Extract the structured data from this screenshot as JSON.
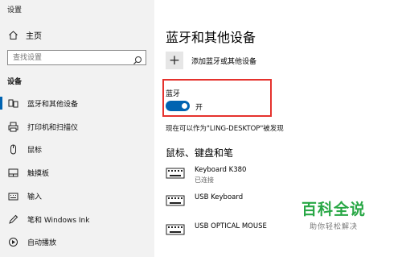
{
  "window": {
    "title": "设置",
    "controls": {
      "minimize": "—",
      "maximize": "☐",
      "close": "✕"
    }
  },
  "sidebar": {
    "home_label": "主页",
    "search_placeholder": "查找设置",
    "section_label": "设备",
    "items": [
      {
        "label": "蓝牙和其他设备",
        "icon": "bluetooth-devices-icon",
        "active": true
      },
      {
        "label": "打印机和扫描仪",
        "icon": "printer-icon"
      },
      {
        "label": "鼠标",
        "icon": "mouse-icon"
      },
      {
        "label": "触摸板",
        "icon": "touchpad-icon"
      },
      {
        "label": "输入",
        "icon": "keyboard-icon"
      },
      {
        "label": "笔和 Windows Ink",
        "icon": "pen-icon"
      },
      {
        "label": "自动播放",
        "icon": "autoplay-icon"
      }
    ]
  },
  "main": {
    "title": "蓝牙和其他设备",
    "add_device_label": "添加蓝牙或其他设备",
    "bluetooth_label": "蓝牙",
    "toggle_state_label": "开",
    "bluetooth_on": true,
    "discoverable_text": "现在可以作为\"LING-DESKTOP\"被发现",
    "section_title": "鼠标、键盘和笔",
    "devices": [
      {
        "name": "Keyboard K380",
        "status": "已连接",
        "icon": "keyboard-icon"
      },
      {
        "name": "USB Keyboard",
        "status": "",
        "icon": "keyboard-icon"
      },
      {
        "name": "USB OPTICAL MOUSE",
        "status": "",
        "icon": "keyboard-icon"
      }
    ]
  },
  "watermark": {
    "big": "百科全说",
    "small": "助你轻松解决"
  },
  "colors": {
    "accent": "#0063b1",
    "highlight_box": "#e5322d",
    "watermark": "#28a745",
    "sidebar_bg": "#f2f2f2"
  }
}
